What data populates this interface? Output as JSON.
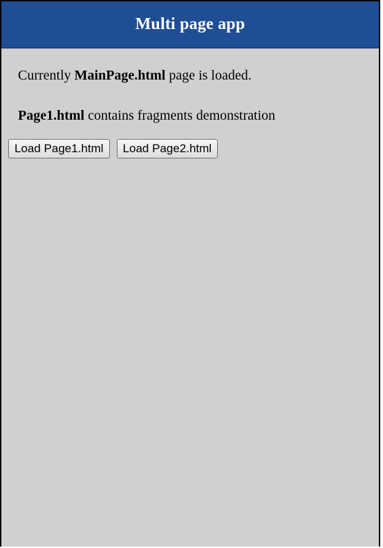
{
  "header": {
    "title": "Multi page app"
  },
  "main": {
    "line1": {
      "prefix": "Currently ",
      "bold": "MainPage.html",
      "suffix": " page is loaded."
    },
    "line2": {
      "bold": "Page1.html",
      "suffix": " contains fragments demonstration"
    },
    "buttons": [
      {
        "label": "Load Page1.html"
      },
      {
        "label": "Load Page2.html"
      }
    ]
  },
  "colors": {
    "header_bg": "#1f4e94",
    "page_bg": "#d0d0d0",
    "header_text": "#ffffff"
  }
}
